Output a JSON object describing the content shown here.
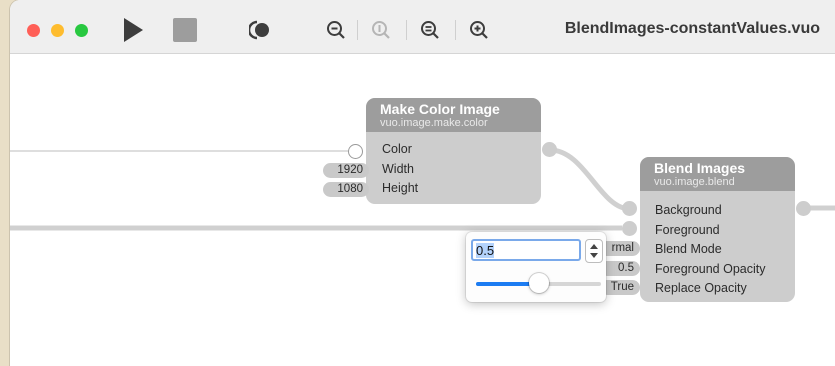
{
  "window": {
    "title": "BlendImages-constantValues.vuo"
  },
  "toolbar": {
    "run_icon": "play-icon",
    "stop_icon": "stop-icon",
    "show_events_icon": "show-events-icon",
    "zoom_out_icon": "zoom-out-icon",
    "zoom_actual_icon": "zoom-actual-size-icon",
    "zoom_to_fit_icon": "zoom-to-fit-icon",
    "zoom_in_icon": "zoom-in-icon"
  },
  "nodes": {
    "make_color_image": {
      "title": "Make Color Image",
      "class_name": "vuo.image.make.color",
      "ports": [
        "Color",
        "Width",
        "Height"
      ],
      "constants": {
        "width": "1920",
        "height": "1080"
      }
    },
    "blend_images": {
      "title": "Blend Images",
      "class_name": "vuo.image.blend",
      "ports": [
        "Background",
        "Foreground",
        "Blend Mode",
        "Foreground Opacity",
        "Replace Opacity"
      ],
      "constants": {
        "blend_mode": "rmal",
        "foreground_opacity": "0.5",
        "replace_opacity": "True"
      }
    }
  },
  "popover": {
    "value": "0.5",
    "slider_fraction": 0.5
  },
  "colors": {
    "node_body": "#cdcdcd",
    "node_header": "#9d9d9d",
    "accent": "#1c7cf2"
  }
}
